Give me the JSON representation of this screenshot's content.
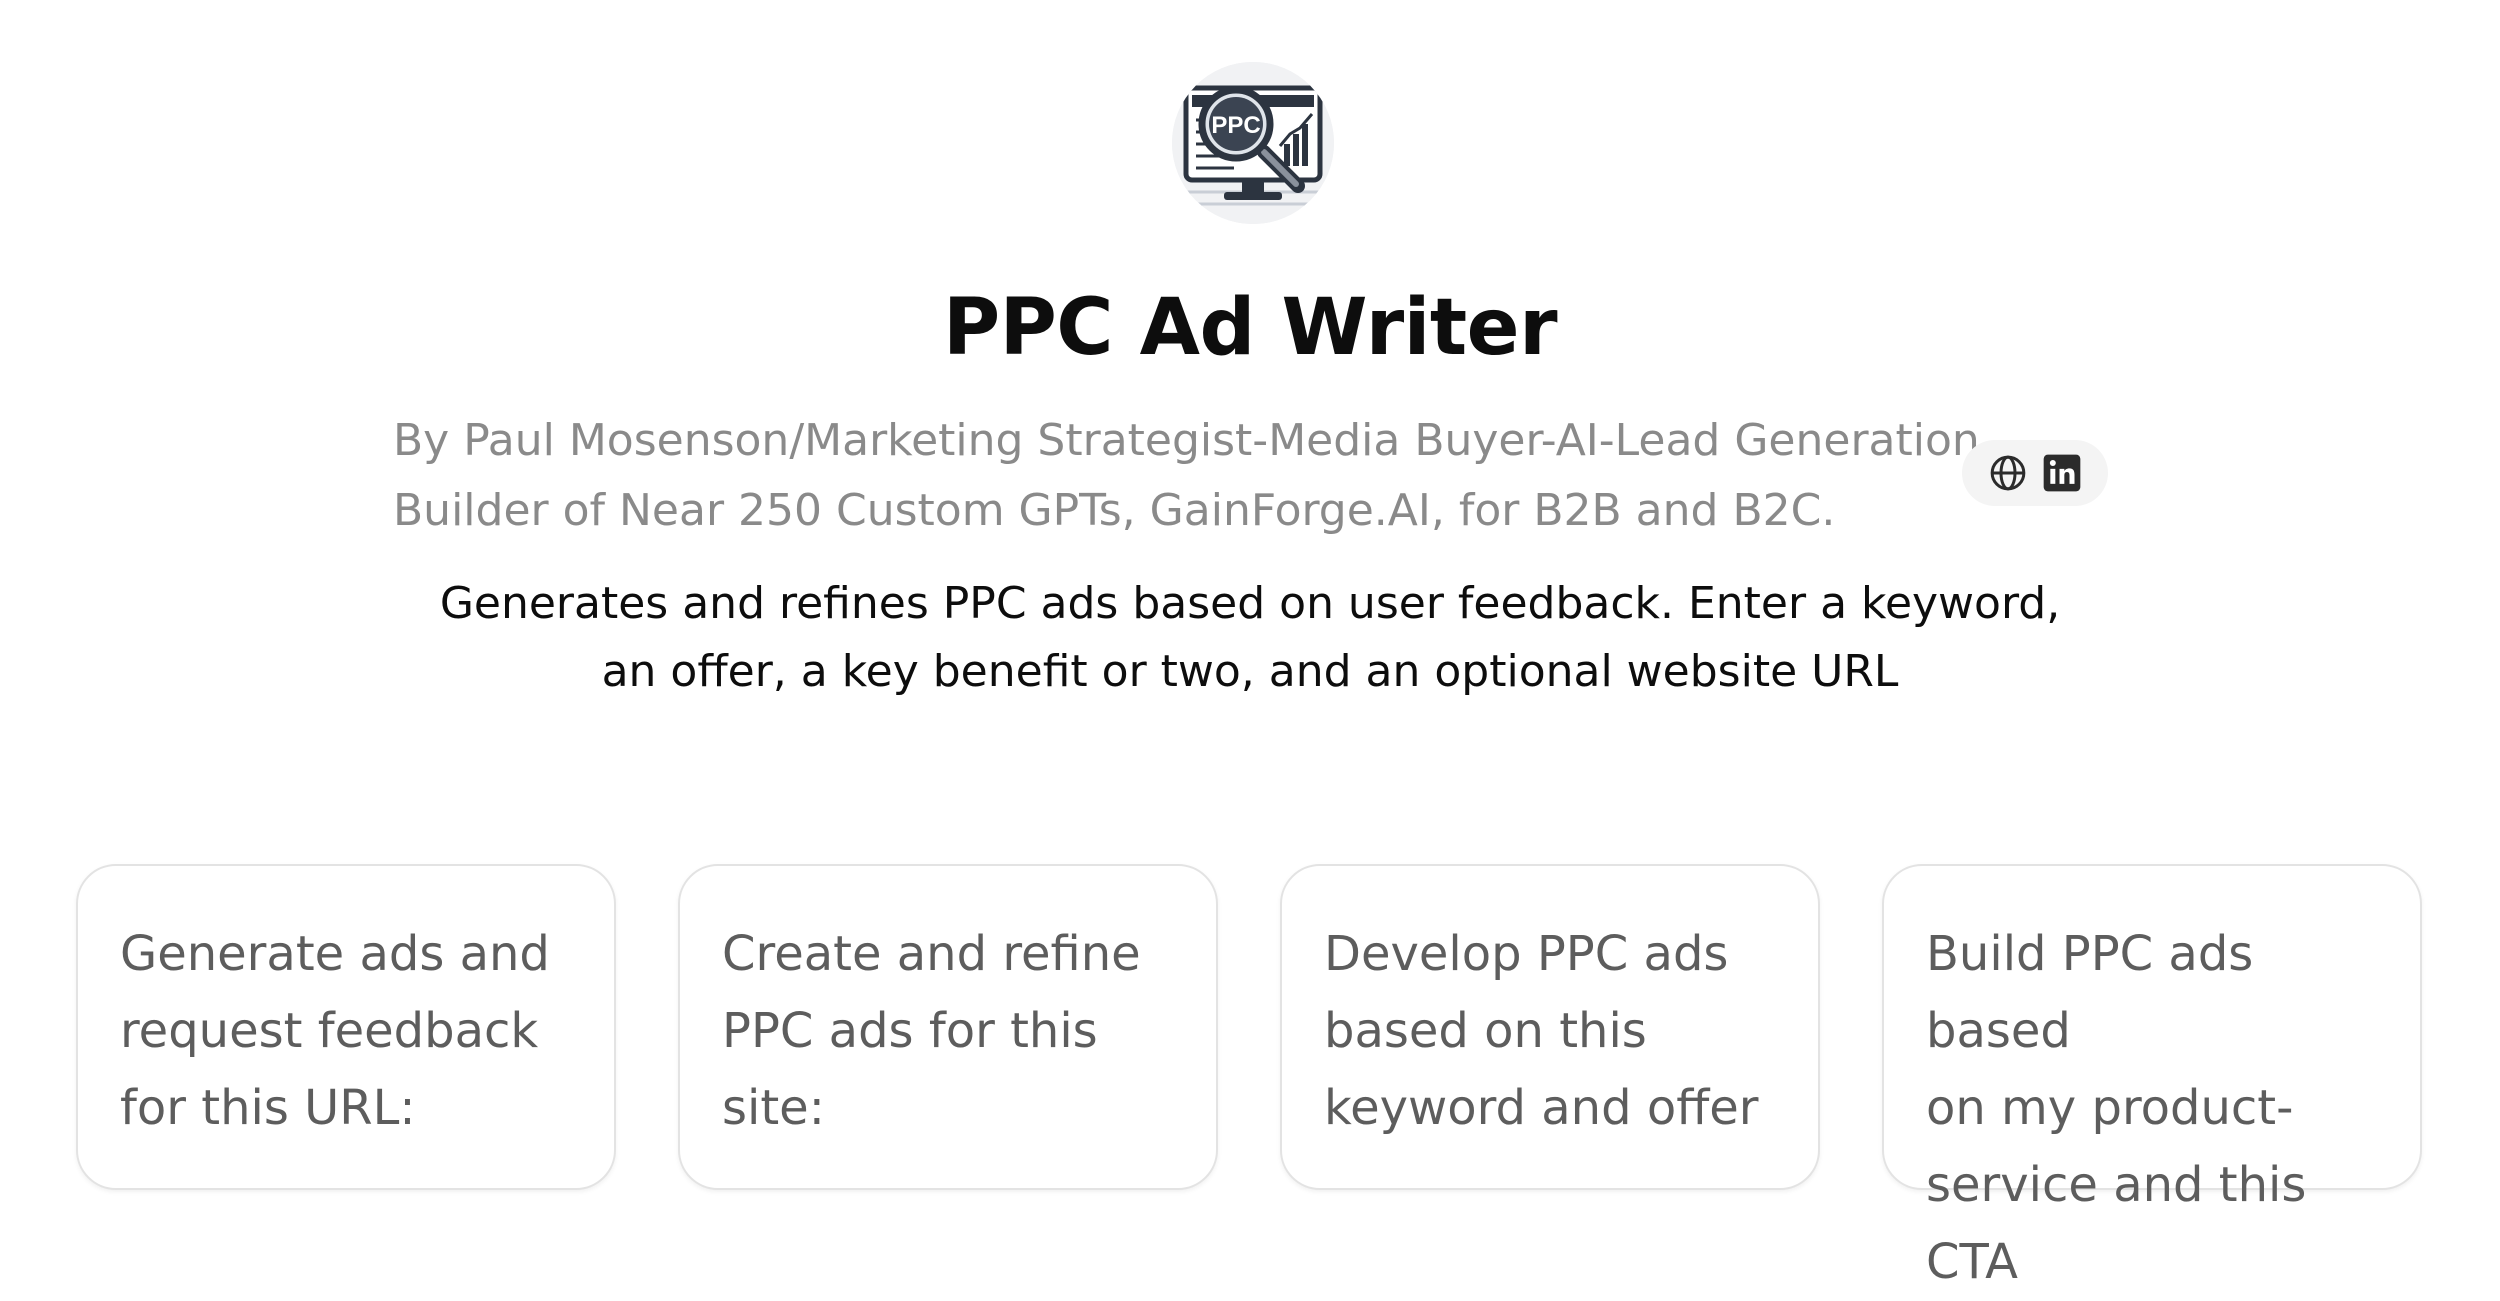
{
  "gpt": {
    "avatar_icon": "ppc-magnifier-monitor-logo",
    "avatar_text": "PPC",
    "title": "PPC Ad Writer",
    "author_lines": [
      "By Paul Mosenson/Marketing Strategist-Media Buyer-AI-Lead Generation.",
      "Builder of Near 250 Custom GPTs, GainForge.AI, for B2B and B2C."
    ],
    "social_links": [
      {
        "icon": "globe-icon",
        "label": "Website"
      },
      {
        "icon": "linkedin-icon",
        "label": "LinkedIn"
      }
    ],
    "description_lines": [
      "Generates and refines PPC ads based on user feedback. Enter a keyword,",
      "an offer, a key benefit or two, and an optional website URL"
    ]
  },
  "starters": [
    {
      "text": "Generate ads and\nrequest feedback\nfor this URL:"
    },
    {
      "text": "Create and refine\nPPC ads for this site:"
    },
    {
      "text": "Develop PPC ads\nbased on this\nkeyword and offer"
    },
    {
      "text": "Build PPC ads based\non my product-\nservice and this CTA"
    }
  ],
  "colors": {
    "title": "#0d0d0d",
    "author": "#8a8a8a",
    "card_text": "#5d5d5d",
    "card_border": "#e3e3e3",
    "social_bg": "#f4f4f4"
  }
}
